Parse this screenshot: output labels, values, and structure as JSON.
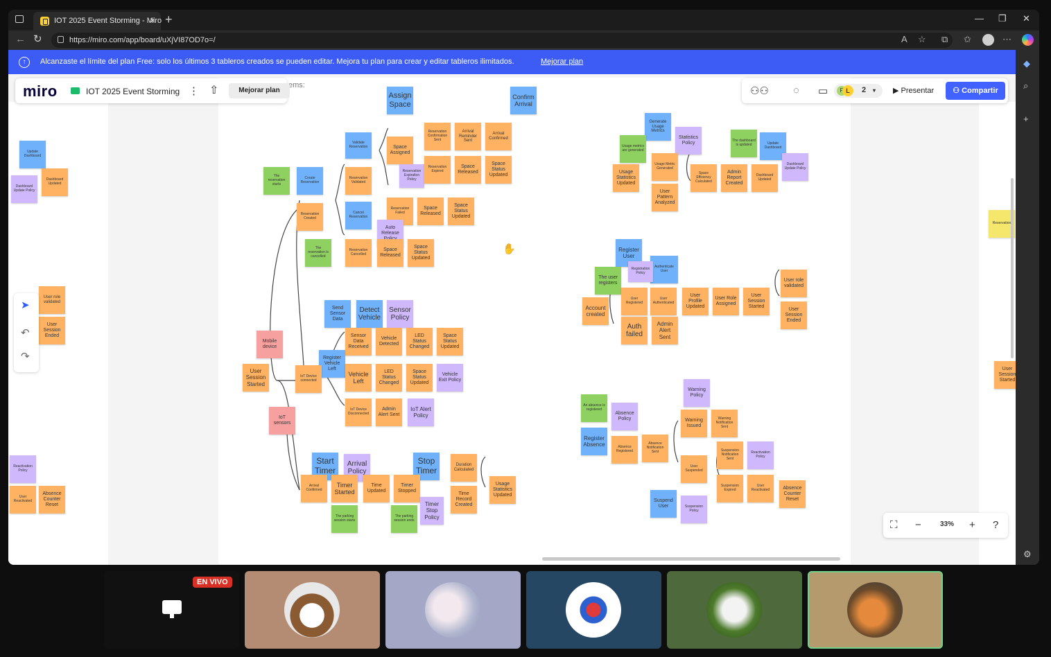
{
  "browser": {
    "tab_title": "IOT 2025 Event Storming - Miro",
    "url": "https://miro.com/app/board/uXjVI87OD7o=/"
  },
  "banner": {
    "text": "Alcanzaste el límite del plan Free: solo los últimos 3 tableros creados se pueden editar. Mejora tu plan para crear y editar tableros ilimitados.",
    "link": "Mejorar plan"
  },
  "miro": {
    "logo": "miro",
    "board_name": "IOT 2025 Event Storming",
    "upgrade_button": "Mejorar plan",
    "frame_label": "ems:",
    "collaborator_initials": [
      "F",
      "L"
    ],
    "collaborator_count": "2",
    "present_button": "Presentar",
    "share_button": "Compartir",
    "zoom": "33%"
  },
  "notes": [
    {
      "t": "Assign Space",
      "c": "b"
    },
    {
      "t": "Confirm Arrival",
      "c": "b"
    },
    {
      "t": "Validate Reservation",
      "c": "b"
    },
    {
      "t": "Reservation Confirmation Sent",
      "c": "o"
    },
    {
      "t": "Arrival Reminder Sent",
      "c": "o"
    },
    {
      "t": "Arrival Confirmed",
      "c": "o"
    },
    {
      "t": "Space Assigned",
      "c": "o"
    },
    {
      "t": "Reservation Expiration Policy",
      "c": "p"
    },
    {
      "t": "Reservation Expired",
      "c": "o"
    },
    {
      "t": "Space Released",
      "c": "o"
    },
    {
      "t": "Space Status Updated",
      "c": "o"
    },
    {
      "t": "The reservation starts",
      "c": "g"
    },
    {
      "t": "Create Reservation",
      "c": "b"
    },
    {
      "t": "Reservation Validated",
      "c": "o"
    },
    {
      "t": "Reservation Failed",
      "c": "o"
    },
    {
      "t": "Space Released",
      "c": "o"
    },
    {
      "t": "Space Status Updated",
      "c": "o"
    },
    {
      "t": "Reservation Created",
      "c": "o"
    },
    {
      "t": "Cancel Reservation",
      "c": "b"
    },
    {
      "t": "Auto Release Policy",
      "c": "p"
    },
    {
      "t": "The reservation is cancelled",
      "c": "g"
    },
    {
      "t": "Reservation Cancelled",
      "c": "o"
    },
    {
      "t": "Space Released",
      "c": "o"
    },
    {
      "t": "Space Status Updated",
      "c": "o"
    },
    {
      "t": "Send Sensor Data",
      "c": "b"
    },
    {
      "t": "Detect Vehicle",
      "c": "b"
    },
    {
      "t": "Sensor Policy",
      "c": "p"
    },
    {
      "t": "Sensor Data Received",
      "c": "o"
    },
    {
      "t": "Vehicle Detected",
      "c": "o"
    },
    {
      "t": "LED Status Changed",
      "c": "o"
    },
    {
      "t": "Space Status Updated",
      "c": "o"
    },
    {
      "t": "Mobile device",
      "c": "r"
    },
    {
      "t": "Register Vehicle Left",
      "c": "b"
    },
    {
      "t": "User Session Started",
      "c": "o"
    },
    {
      "t": "IoT Device connected",
      "c": "o"
    },
    {
      "t": "Vehicle Left",
      "c": "o"
    },
    {
      "t": "LED Status Changed",
      "c": "o"
    },
    {
      "t": "Space Status Updated",
      "c": "o"
    },
    {
      "t": "Vehicle Exit Policy",
      "c": "p"
    },
    {
      "t": "IoT Device Disconnected",
      "c": "o"
    },
    {
      "t": "Admin Alert Sent",
      "c": "o"
    },
    {
      "t": "IoT Alert Policy",
      "c": "p"
    },
    {
      "t": "IoT sensors",
      "c": "r"
    },
    {
      "t": "Start Timer",
      "c": "b"
    },
    {
      "t": "Arrival Policy",
      "c": "p"
    },
    {
      "t": "Stop Timer",
      "c": "b"
    },
    {
      "t": "Duration Calculated",
      "c": "o"
    },
    {
      "t": "Arrival Confirmed",
      "c": "o"
    },
    {
      "t": "Timer Started",
      "c": "o"
    },
    {
      "t": "Time Updated",
      "c": "o"
    },
    {
      "t": "Timer Stopped",
      "c": "o"
    },
    {
      "t": "Timer Stop Policy",
      "c": "p"
    },
    {
      "t": "Time Record Created",
      "c": "o"
    },
    {
      "t": "Usage Statistics Updated",
      "c": "o"
    },
    {
      "t": "The parking session starts",
      "c": "g"
    },
    {
      "t": "The parking session ends",
      "c": "g"
    },
    {
      "t": "Generate Usage Metrics",
      "c": "b"
    },
    {
      "t": "Statistics Policy",
      "c": "p"
    },
    {
      "t": "The dashboard is updated",
      "c": "g"
    },
    {
      "t": "Update Dashboard",
      "c": "b"
    },
    {
      "t": "Usage metrics are generated",
      "c": "g"
    },
    {
      "t": "Dashboard Update Policy",
      "c": "p"
    },
    {
      "t": "Usage Statistics Updated",
      "c": "o"
    },
    {
      "t": "Usage Metric Generated",
      "c": "o"
    },
    {
      "t": "Space Efficiency Calculated",
      "c": "o"
    },
    {
      "t": "Admin Report Created",
      "c": "o"
    },
    {
      "t": "Dashboard Updated",
      "c": "o"
    },
    {
      "t": "User Pattern Analyzed",
      "c": "o"
    },
    {
      "t": "Register User",
      "c": "b"
    },
    {
      "t": "Authenticate User",
      "c": "b"
    },
    {
      "t": "The user registers",
      "c": "g"
    },
    {
      "t": "Registration Policy",
      "c": "p"
    },
    {
      "t": "User role validated",
      "c": "o"
    },
    {
      "t": "User Registered",
      "c": "o"
    },
    {
      "t": "User Authenticated",
      "c": "o"
    },
    {
      "t": "User Profile Updated",
      "c": "o"
    },
    {
      "t": "User Role Assigned",
      "c": "o"
    },
    {
      "t": "User Session Started",
      "c": "o"
    },
    {
      "t": "Account created",
      "c": "o"
    },
    {
      "t": "User Session Ended",
      "c": "o"
    },
    {
      "t": "Auth failed",
      "c": "o"
    },
    {
      "t": "Admin Alert Sent",
      "c": "o"
    },
    {
      "t": "Warning Policy",
      "c": "p"
    },
    {
      "t": "An absence is registered",
      "c": "g"
    },
    {
      "t": "Absence Policy",
      "c": "p"
    },
    {
      "t": "Warning Issued",
      "c": "o"
    },
    {
      "t": "Warning Notification Sent",
      "c": "o"
    },
    {
      "t": "Register Absence",
      "c": "b"
    },
    {
      "t": "Absence Registered",
      "c": "o"
    },
    {
      "t": "Absence Notification Sent",
      "c": "o"
    },
    {
      "t": "Suspension Notification Sent",
      "c": "o"
    },
    {
      "t": "Reactivation Policy",
      "c": "p"
    },
    {
      "t": "User Suspended",
      "c": "o"
    },
    {
      "t": "Absence Counter Reset",
      "c": "o"
    },
    {
      "t": "Suspension Expired",
      "c": "o"
    },
    {
      "t": "User Reactivated",
      "c": "o"
    },
    {
      "t": "Suspend User",
      "c": "b"
    },
    {
      "t": "Suspension Policy",
      "c": "p"
    },
    {
      "t": "Update Dashboard",
      "c": "b"
    },
    {
      "t": "Dashboard Updated",
      "c": "o"
    },
    {
      "t": "Dashboard Update Policy",
      "c": "p"
    },
    {
      "t": "User role validated",
      "c": "o"
    },
    {
      "t": "User Session Ended",
      "c": "o"
    },
    {
      "t": "Reactivation Policy",
      "c": "p"
    },
    {
      "t": "User Reactivated",
      "c": "o"
    },
    {
      "t": "Absence Counter Reset",
      "c": "o"
    },
    {
      "t": "Reservation",
      "c": "y"
    },
    {
      "t": "User Session Started",
      "c": "o"
    }
  ],
  "meet": {
    "live_badge": "EN VIVO",
    "participants": [
      "beagle-avatar",
      "clouds-avatar",
      "cartoon-avatar",
      "puppy-avatar",
      "cat-avatar"
    ]
  }
}
